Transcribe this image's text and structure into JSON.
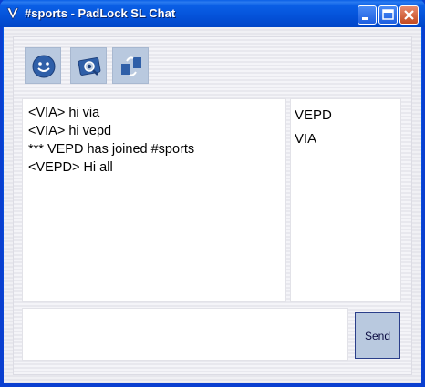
{
  "window": {
    "title": "#sports - PadLock SL Chat",
    "icon": "padlock-app-icon",
    "controls": [
      "minimize-icon",
      "maximize-icon",
      "close-icon"
    ]
  },
  "toolbar": {
    "buttons": [
      {
        "name": "smiley-button",
        "icon": "smiley-icon"
      },
      {
        "name": "photo-button",
        "icon": "camera-photo-icon"
      },
      {
        "name": "swap-button",
        "icon": "arrows-swap-icon"
      }
    ]
  },
  "messages": [
    "<VIA> hi via",
    "<VIA> hi vepd",
    "*** VEPD has joined #sports",
    "<VEPD> Hi all"
  ],
  "users": [
    "VEPD",
    "VIA"
  ],
  "composer": {
    "value": ""
  },
  "send_label": "Send",
  "colors": {
    "titlebar": "#0452d9",
    "tool_button": "#b9c9df",
    "accent": "#2b3f8a"
  }
}
